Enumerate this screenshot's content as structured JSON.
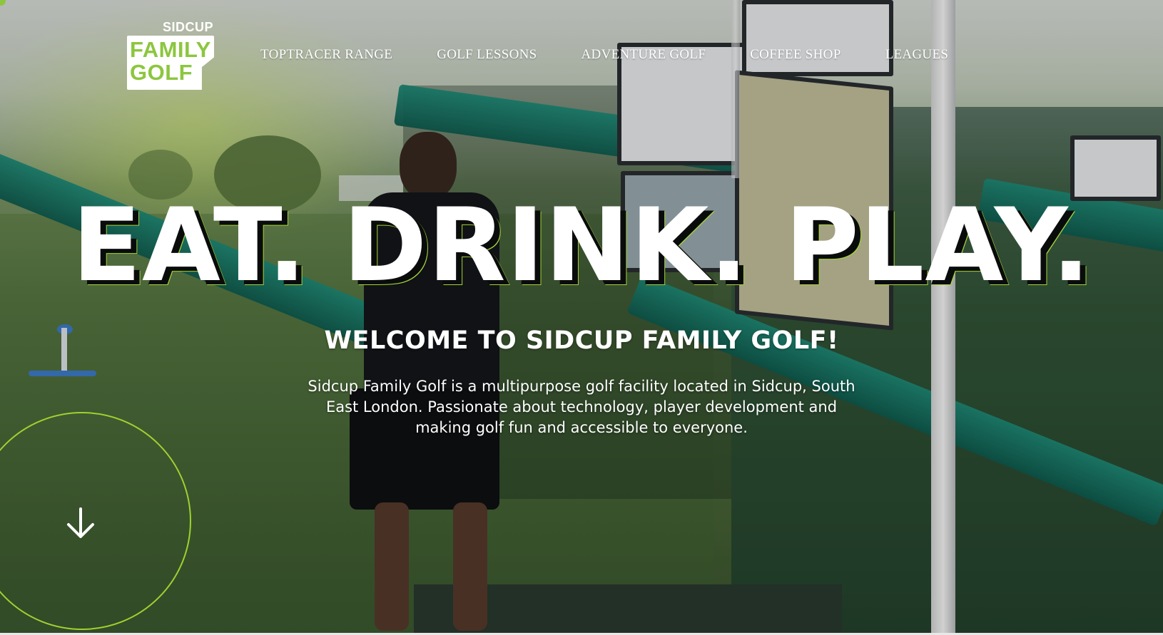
{
  "logo": {
    "top_word": "SIDCUP",
    "line1": "FAMILY",
    "line2": "GOLF"
  },
  "nav": {
    "items": [
      {
        "label": "TOPTRACER RANGE"
      },
      {
        "label": "GOLF LESSONS"
      },
      {
        "label": "ADVENTURE GOLF"
      },
      {
        "label": "COFFEE SHOP"
      },
      {
        "label": "LEAGUES"
      }
    ]
  },
  "hero": {
    "headline": "EAT. DRINK. PLAY.",
    "welcome": "WELCOME TO SIDCUP FAMILY GOLF!",
    "intro": "Sidcup Family Golf is a multipurpose golf facility located in Sidcup, South East London. Passionate about technology, player development and making golf fun and accessible to everyone.",
    "scroll_icon": "arrow-down-icon"
  },
  "colors": {
    "brand_green": "#8cc63f",
    "accent_ring": "#9fd12f",
    "text": "#ffffff"
  }
}
